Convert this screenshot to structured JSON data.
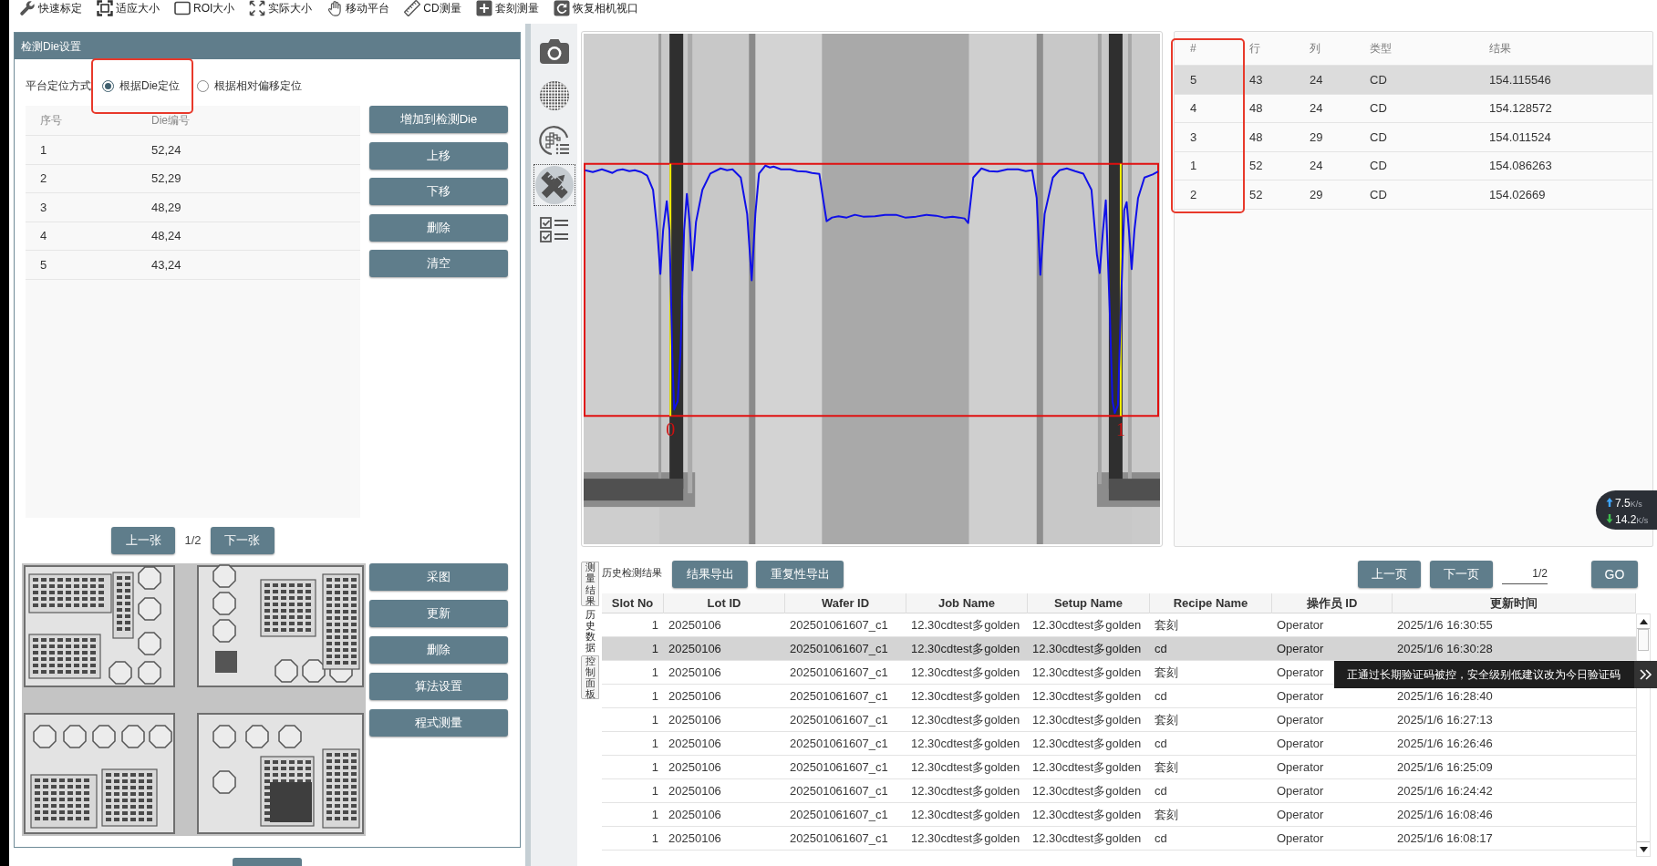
{
  "toolbar": [
    "快速标定",
    "适应大小",
    "ROI大小",
    "实际大小",
    "移动平台",
    "CD测量",
    "套刻测量",
    "恢复相机视口"
  ],
  "die_settings": {
    "title": "检测Die设置",
    "positioning": {
      "label": "平台定位方式",
      "options": [
        {
          "label": "根据Die定位",
          "selected": true
        },
        {
          "label": "根据相对偏移定位",
          "selected": false
        }
      ]
    },
    "die_table": {
      "columns": [
        "序号",
        "Die编号"
      ],
      "rows": [
        [
          "1",
          "52,24"
        ],
        [
          "2",
          "52,29"
        ],
        [
          "3",
          "48,29"
        ],
        [
          "4",
          "48,24"
        ],
        [
          "5",
          "43,24"
        ]
      ]
    },
    "list_buttons": [
      "增加到检测Die",
      "上移",
      "下移",
      "删除",
      "清空"
    ],
    "image_pager": {
      "previous": "上一张",
      "page": "1/2",
      "next": "下一张"
    },
    "image_buttons": [
      "采图",
      "更新",
      "删除",
      "算法设置",
      "程式测量"
    ]
  },
  "tool_rail": [
    {
      "selected": false
    },
    {
      "selected": false
    },
    {
      "selected": false
    },
    {
      "selected": true
    },
    {
      "selected": false
    }
  ],
  "camera_view": {
    "edge_labels": [
      "0",
      "1"
    ]
  },
  "results_table": {
    "columns": [
      "#",
      "行",
      "列",
      "类型",
      "结果"
    ],
    "rows": [
      {
        "cells": [
          "5",
          "43",
          "24",
          "CD",
          "154.115546"
        ],
        "selected": true
      },
      {
        "cells": [
          "4",
          "48",
          "24",
          "CD",
          "154.128572"
        ],
        "selected": false
      },
      {
        "cells": [
          "3",
          "48",
          "29",
          "CD",
          "154.011524"
        ],
        "selected": false
      },
      {
        "cells": [
          "1",
          "52",
          "24",
          "CD",
          "154.086263"
        ],
        "selected": false
      },
      {
        "cells": [
          "2",
          "52",
          "29",
          "CD",
          "154.02669"
        ],
        "selected": false
      }
    ]
  },
  "network_speed": {
    "upload": {
      "value": "7.5",
      "unit": "K/s"
    },
    "download": {
      "value": "14.2",
      "unit": "K/s"
    }
  },
  "side_tabs": [
    {
      "label": "测量结果",
      "selected": false
    },
    {
      "label": "历史数据",
      "selected": true
    },
    {
      "label": "控制面板",
      "selected": false
    }
  ],
  "history": {
    "title": "历史检测结果",
    "export_buttons": [
      "结果导出",
      "重复性导出"
    ],
    "pager": {
      "previous": "上一页",
      "next": "下一页",
      "page": "1/2",
      "go": "GO"
    },
    "columns": [
      "Slot No",
      "Lot ID",
      "Wafer ID",
      "Job Name",
      "Setup Name",
      "Recipe Name",
      "操作员 ID",
      "更新时间"
    ],
    "rows": [
      {
        "cells": [
          "1",
          "20250106",
          "202501061607_c1",
          "12.30cdtest多golden",
          "12.30cdtest多golden",
          "套刻",
          "Operator",
          "2025/1/6 16:30:55"
        ],
        "selected": false
      },
      {
        "cells": [
          "1",
          "20250106",
          "202501061607_c1",
          "12.30cdtest多golden",
          "12.30cdtest多golden",
          "cd",
          "Operator",
          "2025/1/6 16:30:28"
        ],
        "selected": true
      },
      {
        "cells": [
          "1",
          "20250106",
          "202501061607_c1",
          "12.30cdtest多golden",
          "12.30cdtest多golden",
          "套刻",
          "Operator"
        ],
        "selected": false
      },
      {
        "cells": [
          "1",
          "20250106",
          "202501061607_c1",
          "12.30cdtest多golden",
          "12.30cdtest多golden",
          "cd",
          "Operator",
          "2025/1/6 16:28:40"
        ],
        "selected": false
      },
      {
        "cells": [
          "1",
          "20250106",
          "202501061607_c1",
          "12.30cdtest多golden",
          "12.30cdtest多golden",
          "套刻",
          "Operator",
          "2025/1/6 16:27:13"
        ],
        "selected": false
      },
      {
        "cells": [
          "1",
          "20250106",
          "202501061607_c1",
          "12.30cdtest多golden",
          "12.30cdtest多golden",
          "cd",
          "Operator",
          "2025/1/6 16:26:46"
        ],
        "selected": false
      },
      {
        "cells": [
          "1",
          "20250106",
          "202501061607_c1",
          "12.30cdtest多golden",
          "12.30cdtest多golden",
          "套刻",
          "Operator",
          "2025/1/6 16:25:09"
        ],
        "selected": false
      },
      {
        "cells": [
          "1",
          "20250106",
          "202501061607_c1",
          "12.30cdtest多golden",
          "12.30cdtest多golden",
          "cd",
          "Operator",
          "2025/1/6 16:24:42"
        ],
        "selected": false
      },
      {
        "cells": [
          "1",
          "20250106",
          "202501061607_c1",
          "12.30cdtest多golden",
          "12.30cdtest多golden",
          "套刻",
          "Operator",
          "2025/1/6 16:08:46"
        ],
        "selected": false
      },
      {
        "cells": [
          "1",
          "20250106",
          "202501061607_c1",
          "12.30cdtest多golden",
          "12.30cdtest多golden",
          "cd",
          "Operator",
          "2025/1/6 16:08:17"
        ],
        "selected": false
      }
    ]
  },
  "tooltip": {
    "text": "正通过长期验证码被控，安全级别低建议改为今日验证码"
  }
}
